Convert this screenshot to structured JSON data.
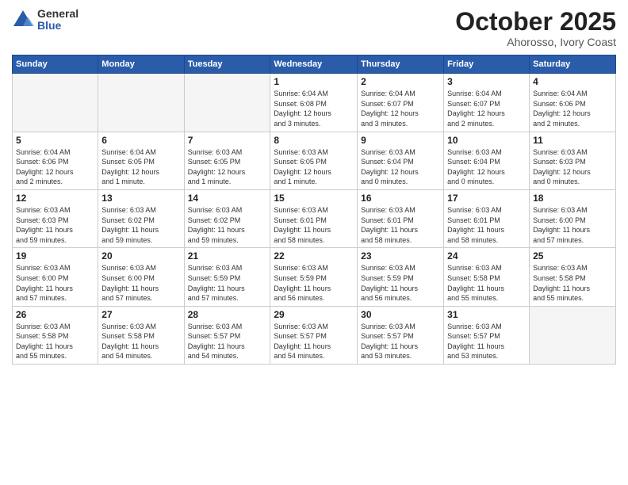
{
  "logo": {
    "general": "General",
    "blue": "Blue"
  },
  "header": {
    "month": "October 2025",
    "location": "Ahorosso, Ivory Coast"
  },
  "weekdays": [
    "Sunday",
    "Monday",
    "Tuesday",
    "Wednesday",
    "Thursday",
    "Friday",
    "Saturday"
  ],
  "weeks": [
    [
      {
        "day": "",
        "info": ""
      },
      {
        "day": "",
        "info": ""
      },
      {
        "day": "",
        "info": ""
      },
      {
        "day": "1",
        "info": "Sunrise: 6:04 AM\nSunset: 6:08 PM\nDaylight: 12 hours\nand 3 minutes."
      },
      {
        "day": "2",
        "info": "Sunrise: 6:04 AM\nSunset: 6:07 PM\nDaylight: 12 hours\nand 3 minutes."
      },
      {
        "day": "3",
        "info": "Sunrise: 6:04 AM\nSunset: 6:07 PM\nDaylight: 12 hours\nand 2 minutes."
      },
      {
        "day": "4",
        "info": "Sunrise: 6:04 AM\nSunset: 6:06 PM\nDaylight: 12 hours\nand 2 minutes."
      }
    ],
    [
      {
        "day": "5",
        "info": "Sunrise: 6:04 AM\nSunset: 6:06 PM\nDaylight: 12 hours\nand 2 minutes."
      },
      {
        "day": "6",
        "info": "Sunrise: 6:04 AM\nSunset: 6:05 PM\nDaylight: 12 hours\nand 1 minute."
      },
      {
        "day": "7",
        "info": "Sunrise: 6:03 AM\nSunset: 6:05 PM\nDaylight: 12 hours\nand 1 minute."
      },
      {
        "day": "8",
        "info": "Sunrise: 6:03 AM\nSunset: 6:05 PM\nDaylight: 12 hours\nand 1 minute."
      },
      {
        "day": "9",
        "info": "Sunrise: 6:03 AM\nSunset: 6:04 PM\nDaylight: 12 hours\nand 0 minutes."
      },
      {
        "day": "10",
        "info": "Sunrise: 6:03 AM\nSunset: 6:04 PM\nDaylight: 12 hours\nand 0 minutes."
      },
      {
        "day": "11",
        "info": "Sunrise: 6:03 AM\nSunset: 6:03 PM\nDaylight: 12 hours\nand 0 minutes."
      }
    ],
    [
      {
        "day": "12",
        "info": "Sunrise: 6:03 AM\nSunset: 6:03 PM\nDaylight: 11 hours\nand 59 minutes."
      },
      {
        "day": "13",
        "info": "Sunrise: 6:03 AM\nSunset: 6:02 PM\nDaylight: 11 hours\nand 59 minutes."
      },
      {
        "day": "14",
        "info": "Sunrise: 6:03 AM\nSunset: 6:02 PM\nDaylight: 11 hours\nand 59 minutes."
      },
      {
        "day": "15",
        "info": "Sunrise: 6:03 AM\nSunset: 6:01 PM\nDaylight: 11 hours\nand 58 minutes."
      },
      {
        "day": "16",
        "info": "Sunrise: 6:03 AM\nSunset: 6:01 PM\nDaylight: 11 hours\nand 58 minutes."
      },
      {
        "day": "17",
        "info": "Sunrise: 6:03 AM\nSunset: 6:01 PM\nDaylight: 11 hours\nand 58 minutes."
      },
      {
        "day": "18",
        "info": "Sunrise: 6:03 AM\nSunset: 6:00 PM\nDaylight: 11 hours\nand 57 minutes."
      }
    ],
    [
      {
        "day": "19",
        "info": "Sunrise: 6:03 AM\nSunset: 6:00 PM\nDaylight: 11 hours\nand 57 minutes."
      },
      {
        "day": "20",
        "info": "Sunrise: 6:03 AM\nSunset: 6:00 PM\nDaylight: 11 hours\nand 57 minutes."
      },
      {
        "day": "21",
        "info": "Sunrise: 6:03 AM\nSunset: 5:59 PM\nDaylight: 11 hours\nand 57 minutes."
      },
      {
        "day": "22",
        "info": "Sunrise: 6:03 AM\nSunset: 5:59 PM\nDaylight: 11 hours\nand 56 minutes."
      },
      {
        "day": "23",
        "info": "Sunrise: 6:03 AM\nSunset: 5:59 PM\nDaylight: 11 hours\nand 56 minutes."
      },
      {
        "day": "24",
        "info": "Sunrise: 6:03 AM\nSunset: 5:58 PM\nDaylight: 11 hours\nand 55 minutes."
      },
      {
        "day": "25",
        "info": "Sunrise: 6:03 AM\nSunset: 5:58 PM\nDaylight: 11 hours\nand 55 minutes."
      }
    ],
    [
      {
        "day": "26",
        "info": "Sunrise: 6:03 AM\nSunset: 5:58 PM\nDaylight: 11 hours\nand 55 minutes."
      },
      {
        "day": "27",
        "info": "Sunrise: 6:03 AM\nSunset: 5:58 PM\nDaylight: 11 hours\nand 54 minutes."
      },
      {
        "day": "28",
        "info": "Sunrise: 6:03 AM\nSunset: 5:57 PM\nDaylight: 11 hours\nand 54 minutes."
      },
      {
        "day": "29",
        "info": "Sunrise: 6:03 AM\nSunset: 5:57 PM\nDaylight: 11 hours\nand 54 minutes."
      },
      {
        "day": "30",
        "info": "Sunrise: 6:03 AM\nSunset: 5:57 PM\nDaylight: 11 hours\nand 53 minutes."
      },
      {
        "day": "31",
        "info": "Sunrise: 6:03 AM\nSunset: 5:57 PM\nDaylight: 11 hours\nand 53 minutes."
      },
      {
        "day": "",
        "info": ""
      }
    ]
  ]
}
